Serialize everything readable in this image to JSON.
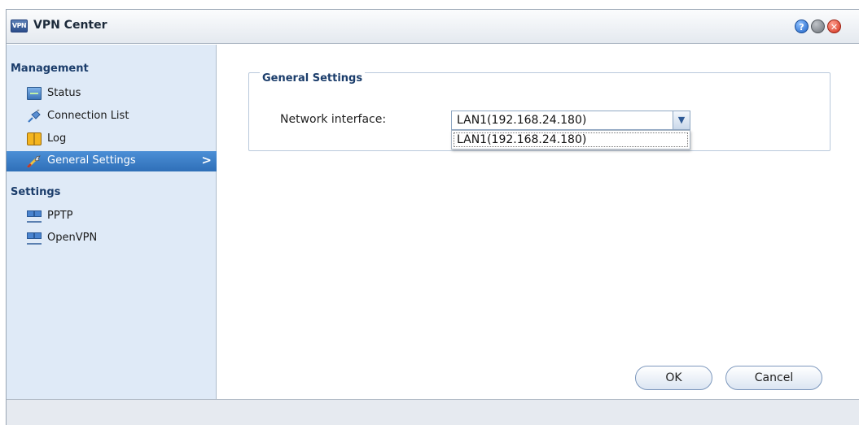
{
  "window": {
    "title": "VPN Center",
    "app_icon_text": "VPN",
    "controls": {
      "help": "?",
      "minimize": "–",
      "close": "✕"
    }
  },
  "sidebar": {
    "management_title": "Management",
    "management_items": [
      {
        "label": "Status",
        "icon": "status-monitor-icon"
      },
      {
        "label": "Connection List",
        "icon": "connection-plug-icon"
      },
      {
        "label": "Log",
        "icon": "book-icon"
      },
      {
        "label": "General Settings",
        "icon": "wrench-icon",
        "selected": true
      }
    ],
    "settings_title": "Settings",
    "settings_items": [
      {
        "label": "PPTP",
        "icon": "network-computers-icon"
      },
      {
        "label": "OpenVPN",
        "icon": "network-computers-icon"
      }
    ],
    "selected_chevron": ">"
  },
  "main": {
    "group_title": "General Settings",
    "network_interface_label": "Network interface:",
    "network_interface_value": "LAN1(192.168.24.180)",
    "dropdown_options": [
      "LAN1(192.168.24.180)"
    ]
  },
  "buttons": {
    "ok": "OK",
    "cancel": "Cancel"
  },
  "colors": {
    "selected_item": "#3a7dc8",
    "sidebar_bg": "#dfeaf7",
    "heading_text": "#1b3d6b"
  }
}
